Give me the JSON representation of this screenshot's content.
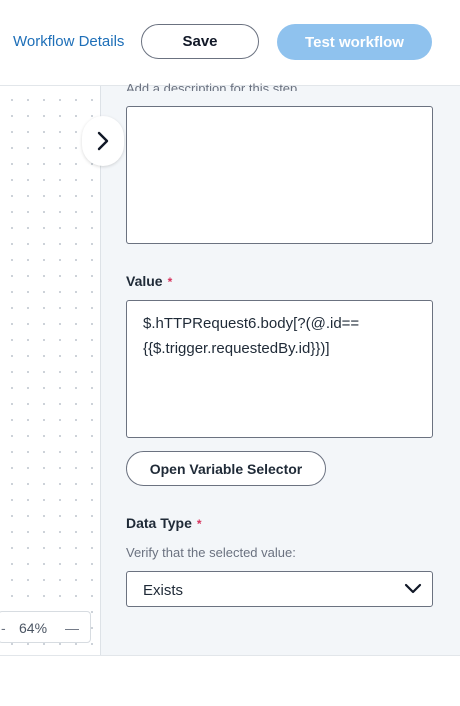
{
  "header": {
    "workflow_details": "Workflow Details",
    "save_label": "Save",
    "test_label": "Test workflow"
  },
  "canvas": {
    "zoom_level": "64%",
    "zoom_out": "-",
    "zoom_in": "—"
  },
  "panel": {
    "description_hint": "Add a description for this step",
    "description_value": "",
    "value_label": "Value",
    "required_mark": "*",
    "value_text_line1": "$.hTTPRequest6.body[?(@.id==",
    "value_text_line2": "{{$.trigger.requestedBy.id}})]",
    "variable_selector_label": "Open Variable Selector",
    "data_type_label": "Data Type",
    "data_type_help": "Verify that the selected value:",
    "data_type_selected": "Exists"
  },
  "colors": {
    "link": "#1e6fb8",
    "primary_disabled": "#8fc2ee",
    "required": "#d6335d",
    "panel_bg": "#f3f6f9"
  },
  "icons": [
    "chevron-right-icon",
    "chevron-down-icon"
  ]
}
